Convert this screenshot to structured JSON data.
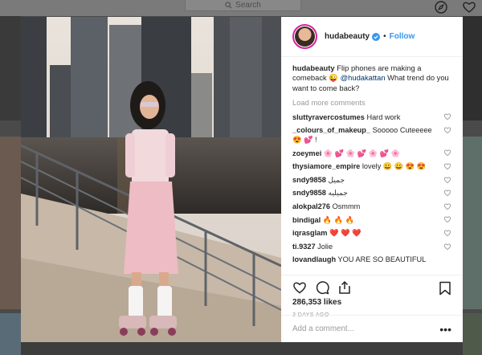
{
  "topbar": {
    "search_placeholder": "Search"
  },
  "post": {
    "username": "hudabeauty",
    "separator": "•",
    "follow_label": "Follow",
    "caption_user": "hudabeauty",
    "caption_text": "Flip phones are making a comeback 😜",
    "caption_mention": "@hudakattan",
    "caption_rest": "What trend do you want to come back?",
    "load_more": "Load more comments",
    "comments": [
      {
        "user": "sluttyravercostumes",
        "text": "Hard work"
      },
      {
        "user": "_colours_of_makeup_",
        "text": "Sooooo Cuteeeee😍 💕 !"
      },
      {
        "user": "zoeymei",
        "text": "🌸 💕 🌸 💕 🌸 💕 🌸"
      },
      {
        "user": "thysiamore_empire",
        "text": "lovely 😀 😀 😍 😍"
      },
      {
        "user": "sndy9858",
        "text": "جمیل"
      },
      {
        "user": "sndy9858",
        "text": "جمیلیه"
      },
      {
        "user": "alokpal276",
        "text": "Osmmm"
      },
      {
        "user": "bindigal",
        "text": "🔥 🔥 🔥"
      },
      {
        "user": "iqrasglam",
        "text": "❤️ ❤️ ❤️"
      },
      {
        "user": "ti.9327",
        "text": "Jolie"
      },
      {
        "user": "lovandlaugh",
        "text": "YOU ARE SO BEAUTIFUL"
      }
    ],
    "likes": "286,353 likes",
    "time_ago": "3 DAYS AGO",
    "add_comment_placeholder": "Add a comment...",
    "more_label": "•••"
  },
  "colors": {
    "link": "#3897f0",
    "text": "#262626",
    "muted": "#999999"
  },
  "icons": [
    "search-icon",
    "compass-icon",
    "heart-icon",
    "verified-icon",
    "comment-icon",
    "share-icon",
    "bookmark-icon",
    "like-small-icon"
  ]
}
